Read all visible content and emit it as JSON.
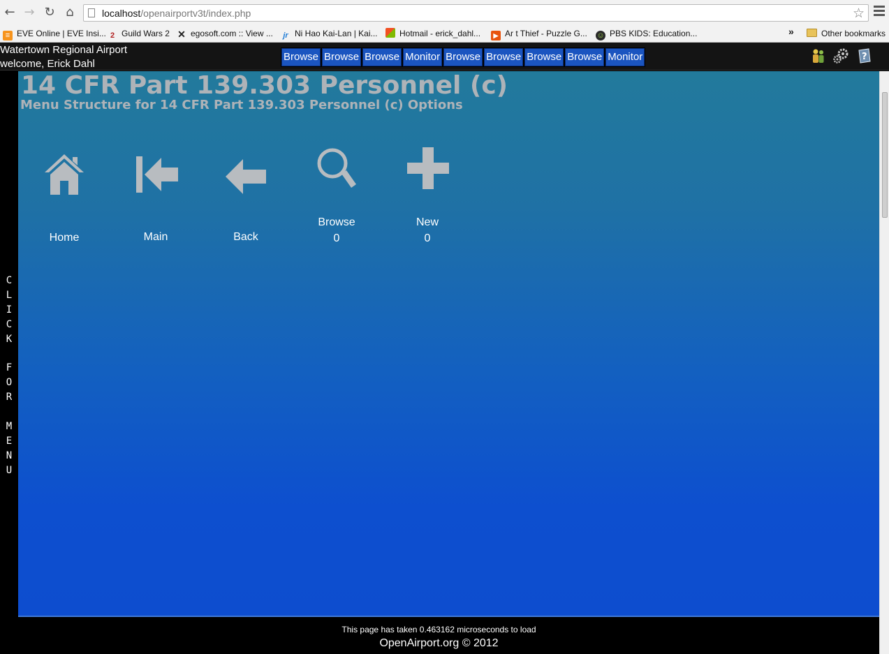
{
  "browser": {
    "url_host": "localhost",
    "url_path": "/openairportv3t/index.php",
    "bookmarks": [
      {
        "label": "EVE Online | EVE Insi...",
        "icon": "eve-icon"
      },
      {
        "label": "Guild Wars 2",
        "icon": "guildwars-icon"
      },
      {
        "label": "egosoft.com :: View ...",
        "icon": "egosoft-icon"
      },
      {
        "label": "Ni Hao Kai-Lan | Kai...",
        "icon": "nickjr-icon"
      },
      {
        "label": "Hotmail - erick_dahl...",
        "icon": "windows-icon"
      },
      {
        "label": "Ar t Thief - Puzzle G...",
        "icon": "play-icon"
      },
      {
        "label": "PBS KIDS: Education...",
        "icon": "pbs-icon"
      }
    ],
    "overflow_label": "»",
    "other_bookmarks": "Other bookmarks"
  },
  "header": {
    "site_name": "Watertown Regional Airport",
    "welcome": "welcome, Erick Dahl",
    "tabs": [
      "Browse",
      "Browse",
      "Browse",
      "Monitor",
      "Browse",
      "Browse",
      "Browse",
      "Browse",
      "Monitor"
    ]
  },
  "side_menu": {
    "text": "CLICK FOR MENU"
  },
  "page": {
    "title": "14 CFR Part 139.303 Personnel (c)",
    "subtitle": "Menu Structure for 14 CFR Part 139.303 Personnel (c) Options"
  },
  "tiles": {
    "home": {
      "label": "Home",
      "icon": "home-icon"
    },
    "main": {
      "label": "Main",
      "icon": "first-page-icon"
    },
    "back": {
      "label": "Back",
      "icon": "back-arrow-icon"
    },
    "browse": {
      "label": "Browse",
      "count": "0",
      "icon": "magnifier-icon"
    },
    "new": {
      "label": "New",
      "count": "0",
      "icon": "plus-icon"
    }
  },
  "footer": {
    "load_time": "This page has taken 0.463162 microseconds to load",
    "copyright": "OpenAirport.org © 2012"
  },
  "colors": {
    "tab_blue": "#1b55c0",
    "content_top": "#227a9c",
    "content_bottom": "#0d4dcf",
    "title_gray": "#aeb3b8"
  }
}
